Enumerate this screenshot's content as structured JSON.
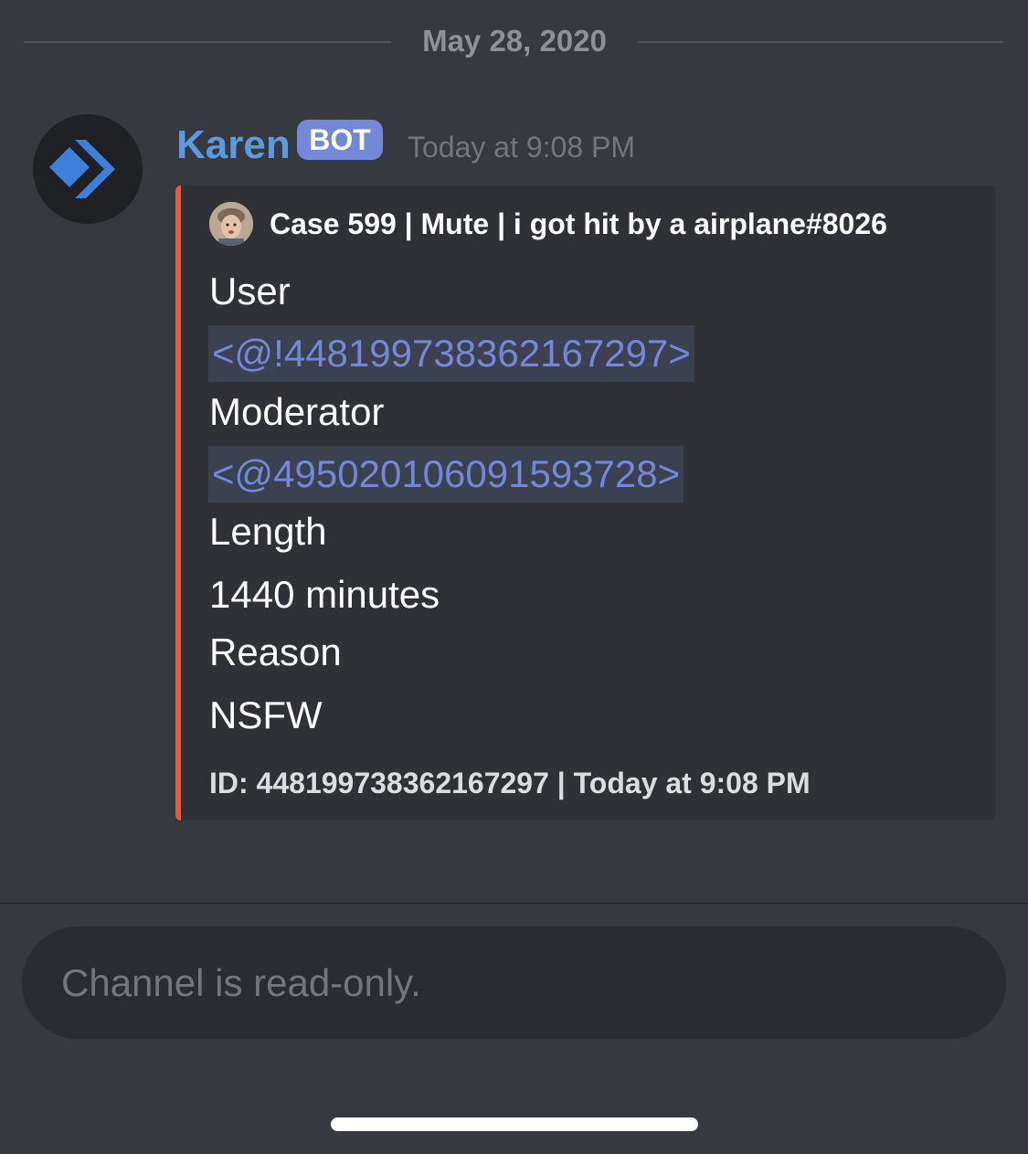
{
  "date_divider": {
    "date": "May 28, 2020"
  },
  "message": {
    "author": "Karen",
    "badge": "BOT",
    "timestamp": "Today at 9:08 PM",
    "avatar_icon": "chevron-diamond-logo"
  },
  "embed": {
    "accent_color": "#e65c3a",
    "author": "Case 599 | Mute | i got hit by a airplane#8026",
    "fields": [
      {
        "name": "User",
        "value": "<@!448199738362167297>"
      },
      {
        "name": "Moderator",
        "value": "<@495020106091593728>"
      },
      {
        "name": "Length",
        "value": "1440 minutes"
      },
      {
        "name": "Reason",
        "value": "NSFW"
      }
    ],
    "footer": "ID: 448199738362167297 | Today at 9:08 PM"
  },
  "input": {
    "placeholder": "Channel is read-only."
  },
  "colors": {
    "background": "#36393f",
    "embed_background": "#2f3136",
    "author_name": "#5a9be0",
    "bot_badge": "#7289da",
    "mention_text": "#7289da",
    "mention_background": "#3c4150"
  }
}
